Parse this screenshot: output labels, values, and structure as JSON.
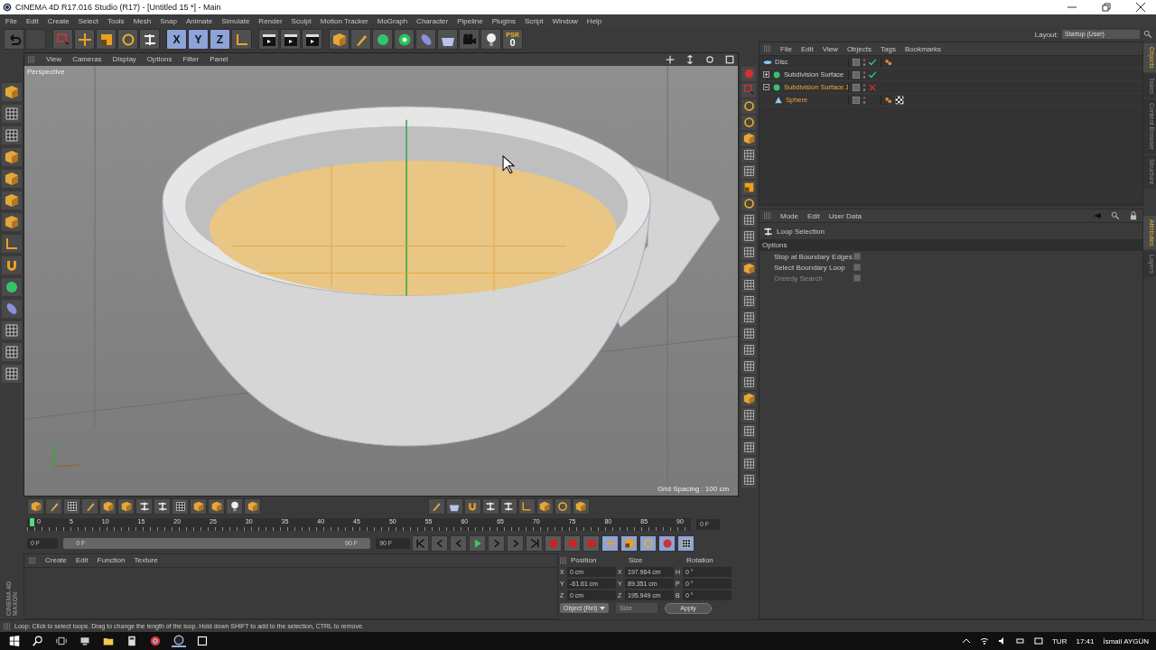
{
  "window": {
    "title": "CINEMA 4D R17.016 Studio (R17) - [Untitled 15 *] - Main"
  },
  "menu": [
    "File",
    "Edit",
    "Create",
    "Select",
    "Tools",
    "Mesh",
    "Snap",
    "Animate",
    "Simulate",
    "Render",
    "Sculpt",
    "Motion Tracker",
    "MoGraph",
    "Character",
    "Pipeline",
    "Plugins",
    "Script",
    "Window",
    "Help"
  ],
  "layout": {
    "label": "Layout:",
    "value": "Startup (User)"
  },
  "toolbar": {
    "axes": [
      {
        "label": "X",
        "selected": true
      },
      {
        "label": "Y",
        "selected": true
      },
      {
        "label": "Z",
        "selected": true
      }
    ],
    "psr": {
      "label": "PSR",
      "value": "0"
    }
  },
  "viewport": {
    "menu": [
      "View",
      "Cameras",
      "Display",
      "Options",
      "Filter",
      "Panel"
    ],
    "camera": "Perspective",
    "grid_spacing": "Grid Spacing : 100 cm"
  },
  "object_manager": {
    "menu": [
      "File",
      "Edit",
      "View",
      "Objects",
      "Tags",
      "Bookmarks"
    ],
    "objects": [
      {
        "name": "Disc",
        "kind": "disc",
        "selected": false,
        "enabled": true,
        "tags": [
          {
            "kind": "material"
          }
        ]
      },
      {
        "name": "Subdivision Surface",
        "kind": "generator",
        "selected": false,
        "enabled": true,
        "expanded": false
      },
      {
        "name": "Subdivision Surface.1",
        "kind": "generator",
        "selected": true,
        "enabled": false,
        "expanded": true,
        "children": [
          {
            "name": "Sphere",
            "kind": "primitive",
            "selected": true,
            "tags": [
              {
                "kind": "material"
              },
              {
                "kind": "texture"
              }
            ]
          }
        ]
      }
    ]
  },
  "side_tabs": [
    {
      "label": "Objects",
      "selected": true
    },
    {
      "label": "Takes",
      "selected": false
    },
    {
      "label": "Content Browser",
      "selected": false
    },
    {
      "label": "Structure",
      "selected": false
    }
  ],
  "attributes": {
    "menu": [
      "Mode",
      "Edit",
      "User Data"
    ],
    "tool": "Loop Selection",
    "section": "Options",
    "options": [
      {
        "label": "Stop at Boundary Edges",
        "checked": false,
        "disabled": false
      },
      {
        "label": "Select Boundary Loop",
        "checked": false,
        "disabled": false
      },
      {
        "label": "Greedy Search",
        "checked": false,
        "disabled": true
      }
    ]
  },
  "attribute_tabs": [
    {
      "label": "Attributes",
      "selected": true
    },
    {
      "label": "Layers",
      "selected": false
    }
  ],
  "timeline": {
    "ticks": [
      "0",
      "5",
      "10",
      "15",
      "20",
      "25",
      "30",
      "35",
      "40",
      "45",
      "50",
      "55",
      "60",
      "65",
      "70",
      "75",
      "80",
      "85",
      "90"
    ],
    "level": 0,
    "current_frame": "0 F",
    "start": "0 F",
    "range": {
      "start": "0 F",
      "end": "90 F",
      "level": 1
    },
    "end": "90 F"
  },
  "material_manager": {
    "menu": [
      "Create",
      "Edit",
      "Function",
      "Texture"
    ]
  },
  "logo": [
    "MAXON",
    "CINEMA 4D"
  ],
  "coordinates": {
    "headers": [
      "Position",
      "Size",
      "Rotation"
    ],
    "rows": [
      [
        {
          "axis": "X",
          "value": "0 cm"
        },
        {
          "axis": "X",
          "value": "197.964 cm"
        },
        {
          "axis": "H",
          "value": "0 °"
        }
      ],
      [
        {
          "axis": "Y",
          "value": "-61.61 cm"
        },
        {
          "axis": "Y",
          "value": "89.351 cm"
        },
        {
          "axis": "P",
          "value": "0 °"
        }
      ],
      [
        {
          "axis": "Z",
          "value": "0 cm"
        },
        {
          "axis": "Z",
          "value": "195.949 cm"
        },
        {
          "axis": "B",
          "value": "0 °"
        }
      ]
    ],
    "mode": "Object (Rel)",
    "size_mode": {
      "label": "Size",
      "disabled": true
    },
    "apply": "Apply"
  },
  "status": "Loop: Click to select loops. Drag to change the length of the loop. Hold down SHIFT to add to the selection, CTRL to remove.",
  "taskbar": {
    "language": "TUR",
    "time": "17:41",
    "user": "İsmail AYGÜN"
  }
}
